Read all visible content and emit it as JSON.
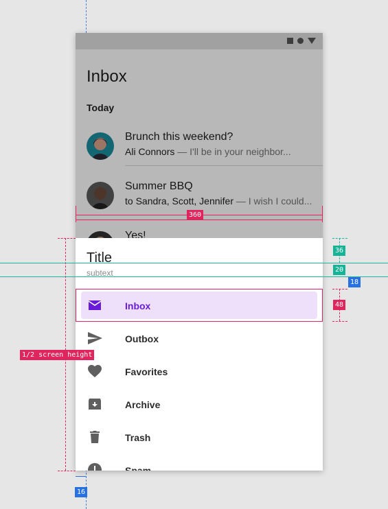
{
  "app_bar": {
    "title": "Inbox"
  },
  "status_bar": {
    "icons": [
      "square-icon",
      "circle-icon",
      "triangle-icon"
    ]
  },
  "list": {
    "section_header": "Today",
    "items": [
      {
        "subject": "Brunch this weekend?",
        "sender": "Ali Connors",
        "preview": "— I'll be in your neighbor..."
      },
      {
        "subject": "Summer BBQ",
        "sender": "to Sandra, Scott, Jennifer",
        "preview": "— I wish I could..."
      },
      {
        "subject": "Yes!",
        "sender": "",
        "preview": ""
      }
    ]
  },
  "drawer": {
    "title": "Title",
    "subtitle": "subtext",
    "items": [
      {
        "label": "Inbox",
        "icon": "mail-icon",
        "active": true
      },
      {
        "label": "Outbox",
        "icon": "send-icon",
        "active": false
      },
      {
        "label": "Favorites",
        "icon": "heart-icon",
        "active": false
      },
      {
        "label": "Archive",
        "icon": "archive-icon",
        "active": false
      },
      {
        "label": "Trash",
        "icon": "trash-icon",
        "active": false
      },
      {
        "label": "Spam",
        "icon": "alert-icon",
        "active": false
      }
    ]
  },
  "annotations": {
    "width_label": "360",
    "header_height_label": "36",
    "subtitle_spacing_label": "20",
    "padding_label": "18",
    "item_height_label": "48",
    "half_height_label": "1/2 screen height",
    "left_padding_label": "16"
  },
  "colors": {
    "accent": "#6a1bd9",
    "active_bg": "#eee0fa",
    "redline": "#e0245e",
    "teal": "#17b397",
    "blue": "#2871e3"
  }
}
